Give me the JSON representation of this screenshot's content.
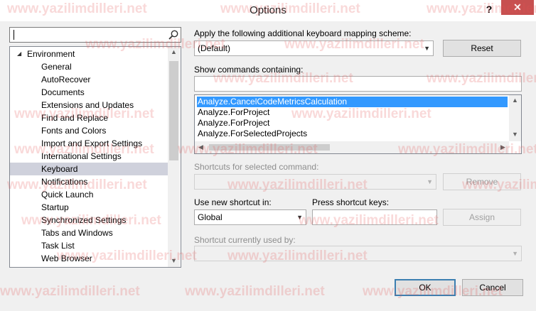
{
  "window": {
    "title": "Options",
    "help_glyph": "?",
    "close_glyph": "✕"
  },
  "search": {
    "value": ""
  },
  "tree": {
    "expand_glyph": "◢",
    "items": [
      {
        "label": "Environment",
        "level": 0,
        "expanded": true
      },
      {
        "label": "General",
        "level": 1
      },
      {
        "label": "AutoRecover",
        "level": 1
      },
      {
        "label": "Documents",
        "level": 1
      },
      {
        "label": "Extensions and Updates",
        "level": 1
      },
      {
        "label": "Find and Replace",
        "level": 1
      },
      {
        "label": "Fonts and Colors",
        "level": 1
      },
      {
        "label": "Import and Export Settings",
        "level": 1
      },
      {
        "label": "International Settings",
        "level": 1
      },
      {
        "label": "Keyboard",
        "level": 1,
        "selected": true
      },
      {
        "label": "Notifications",
        "level": 1
      },
      {
        "label": "Quick Launch",
        "level": 1
      },
      {
        "label": "Startup",
        "level": 1
      },
      {
        "label": "Synchronized Settings",
        "level": 1
      },
      {
        "label": "Tabs and Windows",
        "level": 1
      },
      {
        "label": "Task List",
        "level": 1
      },
      {
        "label": "Web Browser",
        "level": 1
      }
    ]
  },
  "mapping": {
    "label": "Apply the following additional keyboard mapping scheme:",
    "value": "(Default)",
    "reset_label": "Reset"
  },
  "commands": {
    "label": "Show commands containing:",
    "filter_value": "",
    "items": [
      {
        "label": "Analyze.CancelCodeMetricsCalculation",
        "selected": true
      },
      {
        "label": "Analyze.ForProject"
      },
      {
        "label": "Analyze.ForProject"
      },
      {
        "label": "Analyze.ForSelectedProjects"
      }
    ]
  },
  "shortcuts": {
    "selected_label": "Shortcuts for selected command:",
    "remove_label": "Remove",
    "use_in_label": "Use new shortcut in:",
    "use_in_value": "Global",
    "press_keys_label": "Press shortcut keys:",
    "press_keys_value": "",
    "assign_label": "Assign",
    "used_by_label": "Shortcut currently used by:"
  },
  "footer": {
    "ok_label": "OK",
    "cancel_label": "Cancel"
  },
  "watermark": {
    "text": "www.yazilimdilleri.net"
  },
  "colors": {
    "selection_blue": "#3399ff",
    "tree_selected": "#cfd1dc",
    "close_red": "#c75050",
    "watermark": "#e25050"
  }
}
